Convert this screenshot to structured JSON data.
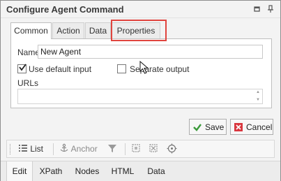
{
  "window": {
    "title": "Configure Agent Command"
  },
  "tabs": [
    {
      "label": "Common",
      "active": true
    },
    {
      "label": "Action",
      "active": false
    },
    {
      "label": "Data",
      "active": false
    },
    {
      "label": "Properties",
      "active": false,
      "highlighted": true
    }
  ],
  "form": {
    "name_label": "Name",
    "name_value": "New Agent",
    "use_default_input": {
      "label": "Use default input",
      "checked": true
    },
    "separate_output": {
      "label": "Separate output",
      "checked": false
    },
    "urls_label": "URLs",
    "urls_value": ""
  },
  "buttons": {
    "save": "Save",
    "cancel": "Cancel"
  },
  "toolbar": {
    "list_label": "List",
    "anchor_label": "Anchor"
  },
  "bottom_tabs": [
    {
      "label": "Edit",
      "active": true
    },
    {
      "label": "XPath",
      "active": false
    },
    {
      "label": "Nodes",
      "active": false
    },
    {
      "label": "HTML",
      "active": false
    },
    {
      "label": "Data",
      "active": false
    }
  ],
  "colors": {
    "highlight": "#e0443e",
    "save_icon": "#3a9a3a",
    "cancel_icon": "#d9363e"
  },
  "icons": {
    "restore": "restore-window-icon",
    "pin": "pin-icon",
    "list": "list-icon",
    "anchor": "anchor-icon",
    "filter": "filter-icon",
    "select": "select-element-icon",
    "deselect": "deselect-element-icon",
    "target": "target-icon",
    "save": "checkmark-icon",
    "cancel": "close-icon"
  }
}
